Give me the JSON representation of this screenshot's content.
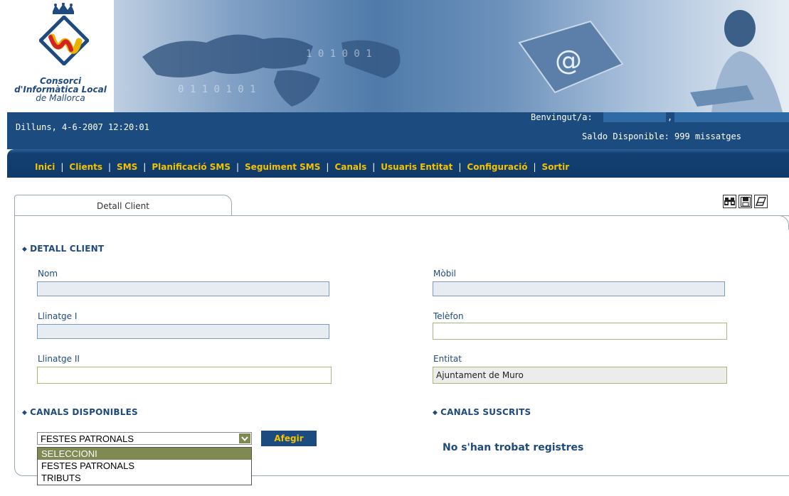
{
  "header": {
    "logo_lines": [
      "Consorci",
      "d'Informàtica Local",
      "de Mallorca"
    ],
    "datetime": "Dilluns, 4-6-2007  12:20:01",
    "welcome_label": "Benvingut/a:",
    "welcome_comma": ",",
    "saldo": "Saldo Disponible: 999 missatges"
  },
  "nav": {
    "items": [
      "Inici",
      "Clients",
      "SMS",
      "Planificació SMS",
      "Seguiment SMS",
      "Canals",
      "Usuaris Entitat",
      "Configuració",
      "Sortir"
    ],
    "separator": "|"
  },
  "tab": {
    "label": "Detall Client"
  },
  "toolbar": {
    "icons": [
      "binoculars-icon",
      "save-icon",
      "eraser-icon"
    ]
  },
  "detail": {
    "section_title": "DETALL CLIENT",
    "fields": {
      "nom": {
        "label": "Nom",
        "value": ""
      },
      "llinatge1": {
        "label": "Llinatge I",
        "value": ""
      },
      "llinatge2": {
        "label": "Llinatge II",
        "value": ""
      },
      "mobil": {
        "label": "Mòbil",
        "value": ""
      },
      "telefon": {
        "label": "Telèfon",
        "value": ""
      },
      "entitat": {
        "label": "Entitat",
        "value": "Ajuntament de Muro"
      }
    }
  },
  "canals_disponibles": {
    "section_title": "CANALS DISPONIBLES",
    "selected": "FESTES PATRONALS",
    "options": [
      "SELECCIONI",
      "FESTES PATRONALS",
      "TRIBUTS"
    ],
    "add_button": "Afegir"
  },
  "canals_suscrits": {
    "section_title": "CANALS SUSCRITS",
    "empty_message": "No s'han trobat registres"
  },
  "colors": {
    "brand_blue": "#1c4b80",
    "nav_text": "#f3c200",
    "label_text": "#1f4a7d",
    "dropdown_highlight": "#7e8a52"
  }
}
